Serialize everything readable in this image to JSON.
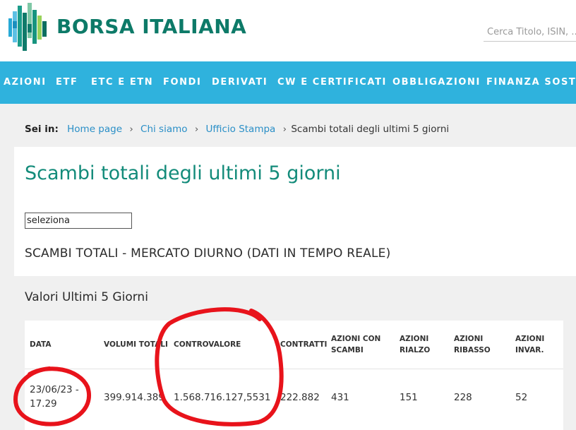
{
  "header": {
    "brand": "BORSA ITALIANA",
    "search_placeholder": "Cerca Titolo, ISIN, ..."
  },
  "nav": {
    "items": [
      "AZIONI",
      "ETF",
      "ETC E ETN",
      "FONDI",
      "DERIVATI",
      "CW E CERTIFICATI",
      "OBBLIGAZIONI",
      "FINANZA SOSTENIBILE"
    ]
  },
  "breadcrumb": {
    "label": "Sei in:",
    "links": [
      "Home page",
      "Chi siamo",
      "Ufficio Stampa"
    ],
    "separator": "›",
    "current": "Scambi totali degli ultimi 5 giorni"
  },
  "main": {
    "title": "Scambi totali degli ultimi 5 giorni",
    "select_value": "seleziona",
    "section_heading": "SCAMBI TOTALI - MERCATO DIURNO (DATI IN TEMPO REALE)",
    "sub_heading": "Valori Ultimi 5 Giorni"
  },
  "table": {
    "headers": [
      "DATA",
      "VOLUMI TOTALI",
      "CONTROVALORE",
      "CONTRATTI",
      "AZIONI CON SCAMBI",
      "AZIONI RIALZO",
      "AZIONI RIBASSO",
      "AZIONI INVAR."
    ],
    "header_lines": [
      [
        "DATA"
      ],
      [
        "VOLUMI TOTALI"
      ],
      [
        "CONTROVALORE"
      ],
      [
        "CONTRATTI"
      ],
      [
        "AZIONI CON",
        "SCAMBI"
      ],
      [
        "AZIONI",
        "RIALZO"
      ],
      [
        "AZIONI",
        "RIBASSO"
      ],
      [
        "AZIONI",
        "INVAR."
      ]
    ],
    "rows": [
      {
        "data_lines": [
          "23/06/23 -",
          "17.29"
        ],
        "volumi": "399.914.389",
        "controvalore": "1.568.716.127,5531",
        "contratti": "222.882",
        "con_scambi": "431",
        "rialzo": "151",
        "ribasso": "228",
        "invariate": "52"
      }
    ]
  },
  "colors": {
    "brand_green": "#0d7a68",
    "title_teal": "#138b7a",
    "nav_blue": "#2fb2dd",
    "link_blue": "#2a8fc7",
    "annotation_red": "#e8131b"
  }
}
